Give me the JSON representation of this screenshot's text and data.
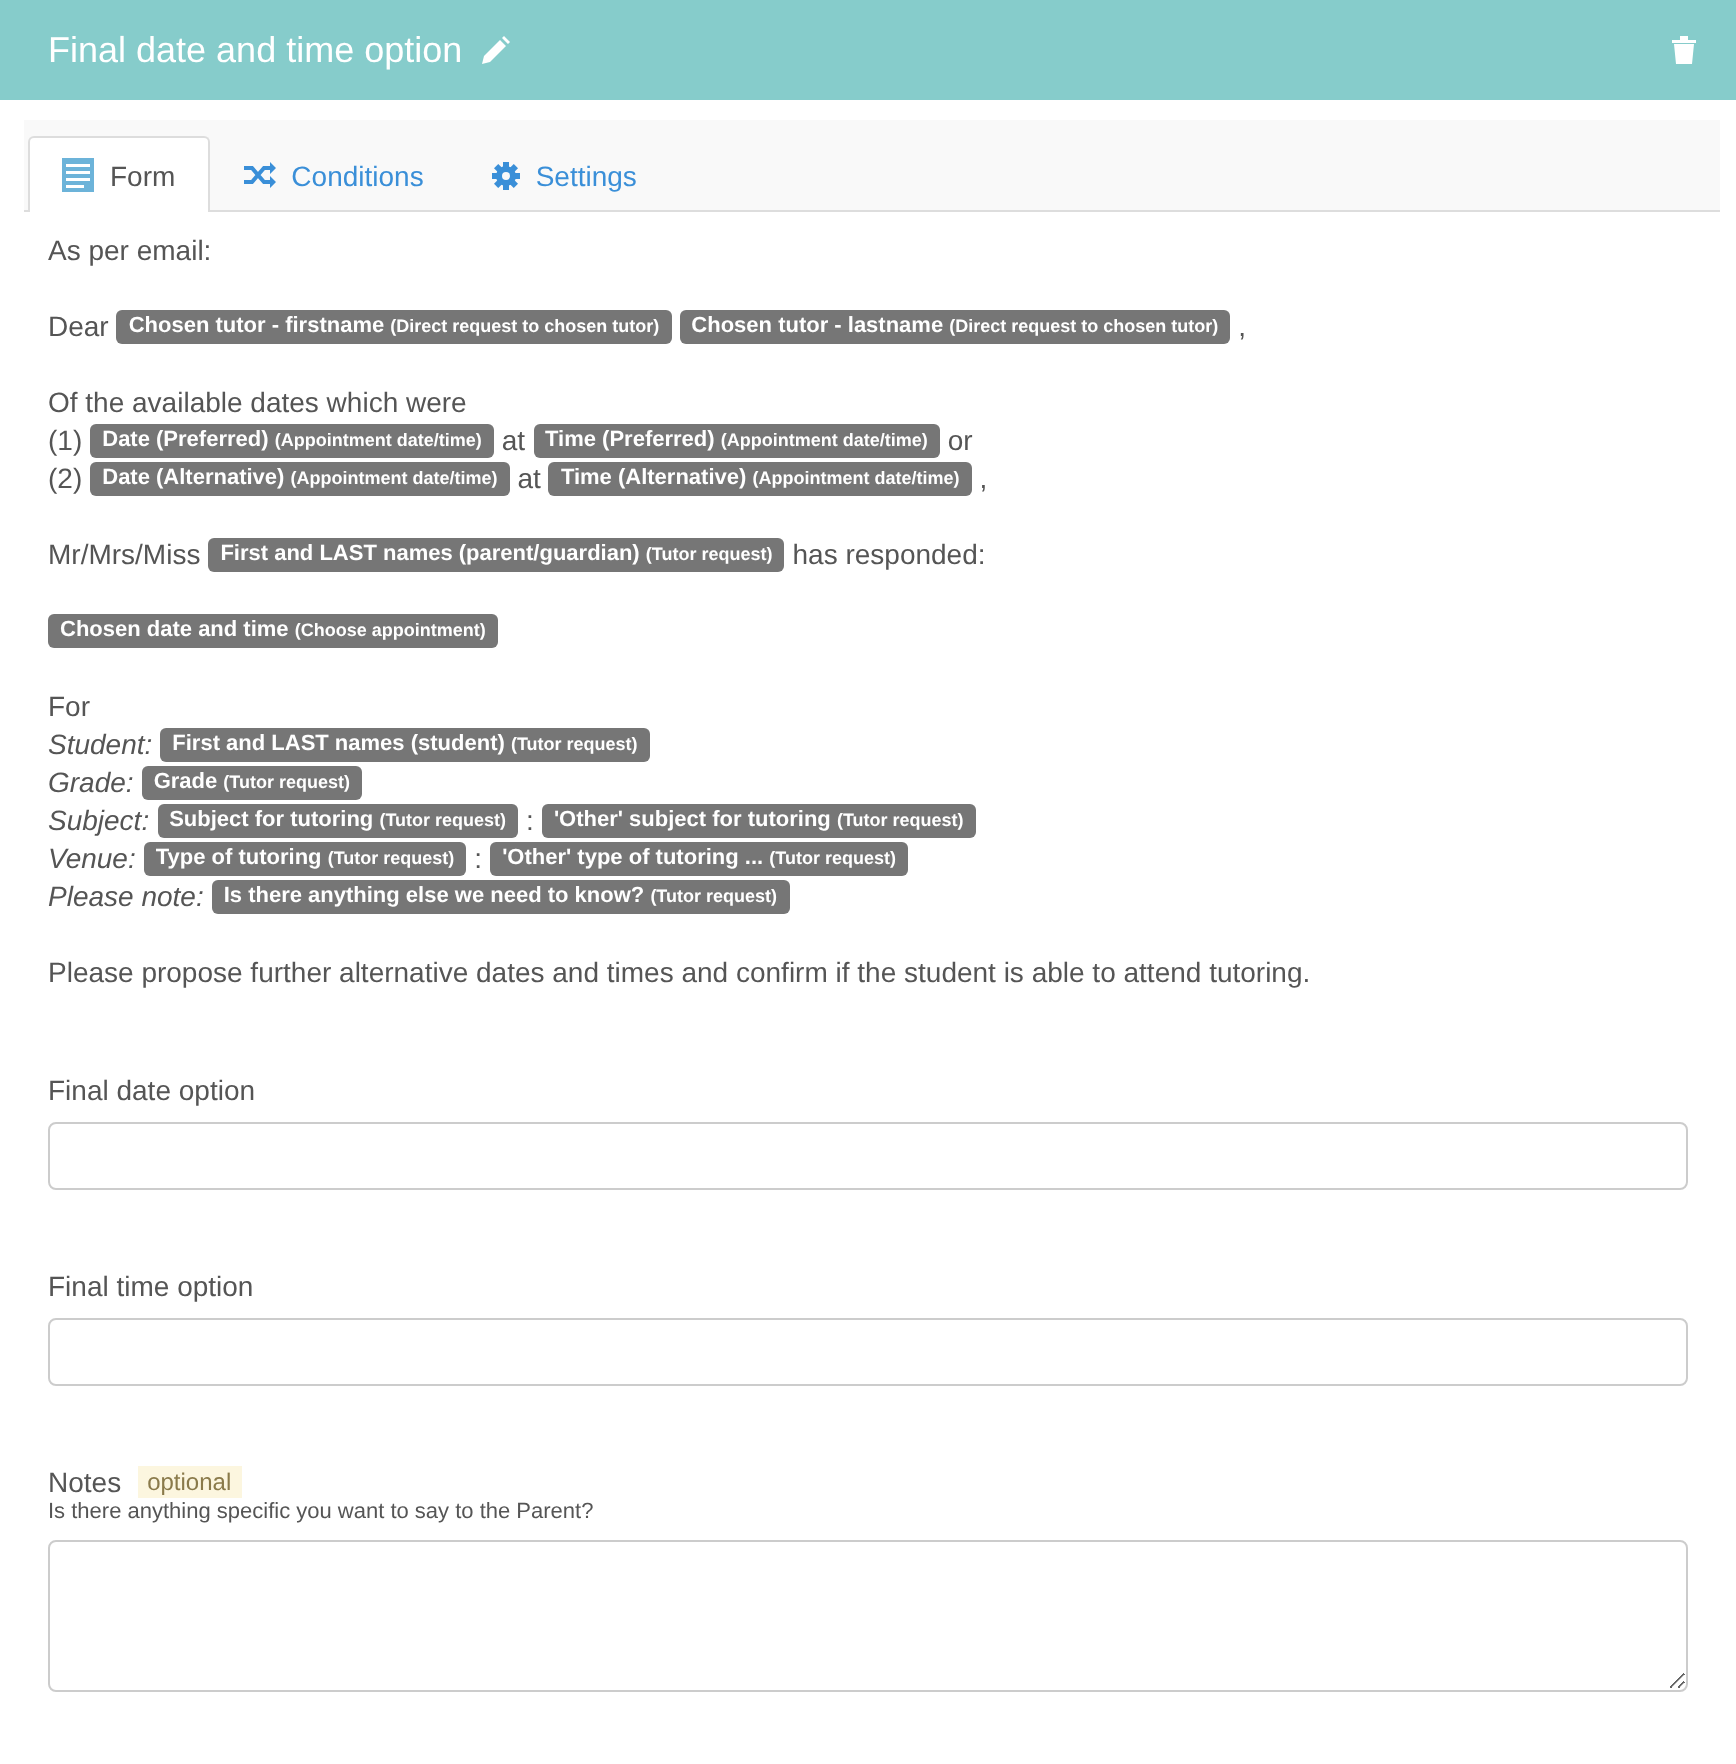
{
  "header": {
    "title": "Final date and time option"
  },
  "tabs": [
    {
      "label": "Form",
      "kind": "form",
      "selected": true
    },
    {
      "label": "Conditions",
      "kind": "conditions",
      "selected": false
    },
    {
      "label": "Settings",
      "kind": "settings",
      "selected": false
    }
  ],
  "message": {
    "paragraphs": [
      {
        "lines": [
          [
            {
              "kind": "text",
              "text": "As per email:"
            }
          ]
        ]
      },
      {
        "lines": [
          [
            {
              "kind": "text",
              "text": "Dear"
            },
            {
              "kind": "tag",
              "name": "Chosen tutor - firstname",
              "source": "(Direct request to chosen tutor)"
            },
            {
              "kind": "tag",
              "name": "Chosen tutor - lastname",
              "source": "(Direct request to chosen tutor)"
            },
            {
              "kind": "text",
              "text": ","
            }
          ]
        ]
      },
      {
        "lines": [
          [
            {
              "kind": "text",
              "text": "Of the available dates which were"
            }
          ],
          [
            {
              "kind": "text",
              "text": "(1)"
            },
            {
              "kind": "tag",
              "name": "Date (Preferred)",
              "source": "(Appointment date/time)"
            },
            {
              "kind": "text",
              "text": "at"
            },
            {
              "kind": "tag",
              "name": "Time (Preferred)",
              "source": "(Appointment date/time)"
            },
            {
              "kind": "text",
              "text": "or"
            }
          ],
          [
            {
              "kind": "text",
              "text": "(2)"
            },
            {
              "kind": "tag",
              "name": "Date (Alternative)",
              "source": "(Appointment date/time)"
            },
            {
              "kind": "text",
              "text": "at"
            },
            {
              "kind": "tag",
              "name": "Time (Alternative)",
              "source": "(Appointment date/time)"
            },
            {
              "kind": "text",
              "text": ","
            }
          ]
        ]
      },
      {
        "lines": [
          [
            {
              "kind": "text",
              "text": "Mr/Mrs/Miss"
            },
            {
              "kind": "tag",
              "name": "First and LAST names (parent/guardian)",
              "source": "(Tutor request)"
            },
            {
              "kind": "text",
              "text": "has responded:"
            }
          ]
        ]
      },
      {
        "lines": [
          [
            {
              "kind": "tag",
              "name": "Chosen date and time",
              "source": "(Choose appointment)"
            }
          ]
        ]
      },
      {
        "lines": [
          [
            {
              "kind": "text",
              "text": "For"
            }
          ],
          [
            {
              "kind": "label",
              "text": "Student:"
            },
            {
              "kind": "tag",
              "name": "First and LAST names (student)",
              "source": "(Tutor request)"
            }
          ],
          [
            {
              "kind": "label",
              "text": "Grade:"
            },
            {
              "kind": "tag",
              "name": "Grade",
              "source": "(Tutor request)"
            }
          ],
          [
            {
              "kind": "label",
              "text": "Subject:"
            },
            {
              "kind": "tag",
              "name": "Subject for tutoring",
              "source": "(Tutor request)"
            },
            {
              "kind": "text",
              "text": ":"
            },
            {
              "kind": "tag",
              "name": "'Other' subject for tutoring",
              "source": "(Tutor request)"
            }
          ],
          [
            {
              "kind": "label",
              "text": "Venue:"
            },
            {
              "kind": "tag",
              "name": "Type of tutoring",
              "source": "(Tutor request)"
            },
            {
              "kind": "text",
              "text": ":"
            },
            {
              "kind": "tag",
              "name": "'Other' type of tutoring ...",
              "source": "(Tutor request)"
            }
          ],
          [
            {
              "kind": "label",
              "text": "Please note:"
            },
            {
              "kind": "tag",
              "name": "Is there anything else we need to know?",
              "source": "(Tutor request)"
            }
          ]
        ]
      },
      {
        "lines": [
          [
            {
              "kind": "text",
              "text": "Please propose further alternative dates and times and confirm if the student is able to attend tutoring."
            }
          ]
        ]
      }
    ]
  },
  "fields": [
    {
      "label": "Final date option",
      "kind": "input"
    },
    {
      "label": "Final time option",
      "kind": "input"
    },
    {
      "label": "Notes",
      "badge": "optional",
      "hint": "Is there anything specific you want to say to the Parent?",
      "kind": "textarea"
    }
  ]
}
